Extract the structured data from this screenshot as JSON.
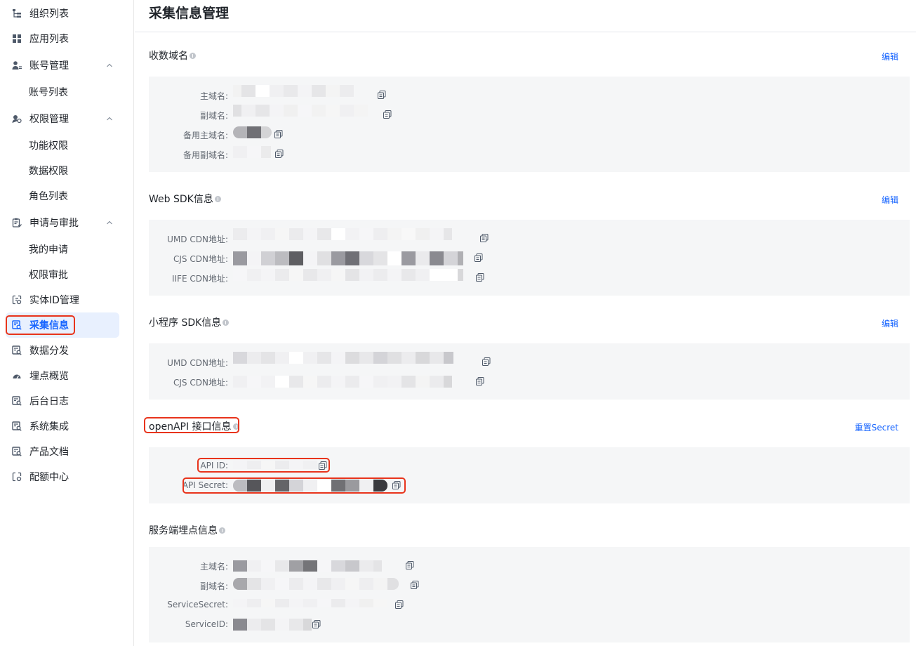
{
  "sidebar": {
    "items": [
      {
        "label": "组织列表",
        "icon": "org-tree-icon"
      },
      {
        "label": "应用列表",
        "icon": "app-grid-icon"
      },
      {
        "label": "账号管理",
        "icon": "user-manage-icon",
        "expanded": true
      },
      {
        "label": "账号列表",
        "sub": true
      },
      {
        "label": "权限管理",
        "icon": "permission-icon",
        "expanded": true
      },
      {
        "label": "功能权限",
        "sub": true
      },
      {
        "label": "数据权限",
        "sub": true
      },
      {
        "label": "角色列表",
        "sub": true
      },
      {
        "label": "申请与审批",
        "icon": "approval-icon",
        "expanded": true
      },
      {
        "label": "我的申请",
        "sub": true
      },
      {
        "label": "权限审批",
        "sub": true
      },
      {
        "label": "实体ID管理",
        "icon": "entity-id-icon"
      },
      {
        "label": "采集信息",
        "icon": "collect-info-icon",
        "active": true
      },
      {
        "label": "数据分发",
        "icon": "data-dist-icon"
      },
      {
        "label": "埋点概览",
        "icon": "tracking-overview-icon"
      },
      {
        "label": "后台日志",
        "icon": "log-icon"
      },
      {
        "label": "系统集成",
        "icon": "integration-icon"
      },
      {
        "label": "产品文档",
        "icon": "doc-icon"
      },
      {
        "label": "配额中心",
        "icon": "quota-icon"
      }
    ]
  },
  "page": {
    "title": "采集信息管理"
  },
  "sections": {
    "domain": {
      "title": "收数域名",
      "action": "编辑",
      "rows": [
        "主域名:",
        "副域名:",
        "备用主域名:",
        "备用副域名:"
      ]
    },
    "websdk": {
      "title": "Web SDK信息",
      "action": "编辑",
      "rows": [
        "UMD CDN地址:",
        "CJS CDN地址:",
        "IIFE CDN地址:"
      ]
    },
    "minisdk": {
      "title": "小程序 SDK信息",
      "action": "编辑",
      "rows": [
        "UMD CDN地址:",
        "CJS CDN地址:"
      ]
    },
    "openapi": {
      "title": "openAPI 接口信息",
      "action": "重置Secret",
      "rows": [
        "API ID:",
        "API Secret:"
      ]
    },
    "server": {
      "title": "服务端埋点信息",
      "rows": [
        "主域名:",
        "副域名:",
        "ServiceSecret:",
        "ServiceID:"
      ]
    }
  },
  "colors": {
    "accent": "#1664ff",
    "highlight": "#e8341c",
    "panel": "#f5f6f7"
  }
}
